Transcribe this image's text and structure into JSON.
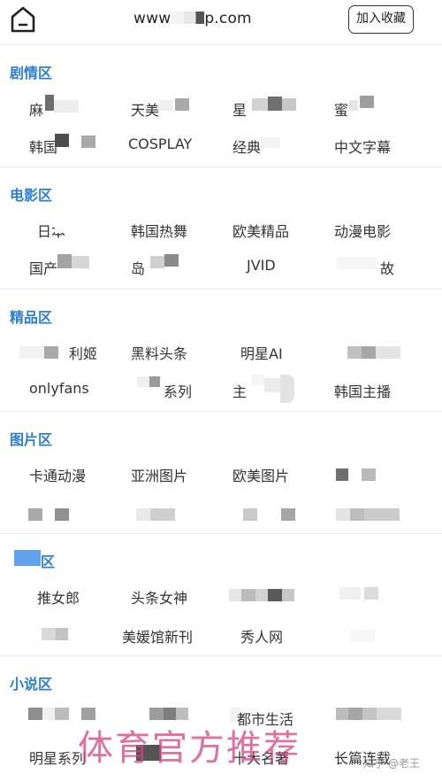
{
  "header": {
    "url_prefix": "www",
    "url_suffix": "p.com",
    "bookmark_label": "加入收藏"
  },
  "sections": [
    {
      "title": "剧情区",
      "items": [
        "麻",
        "天美",
        "星",
        "蜜",
        "韩国",
        "COSPLAY",
        "经典",
        "中文字幕"
      ]
    },
    {
      "title": "电影区",
      "items": [
        "日本",
        "韩国热舞",
        "欧美精品",
        "动漫电影",
        "国产",
        "岛",
        "JVID",
        "故"
      ]
    },
    {
      "title": "精品区",
      "items": [
        "利姬",
        "黑料头条",
        "明星AI",
        "onlyfans",
        "系列",
        "主",
        "韩国主播"
      ]
    },
    {
      "title": "图片区",
      "items": [
        "卡通动漫",
        "亚洲图片",
        "欧美图片"
      ]
    },
    {
      "title": "区",
      "items": [
        "推女郎",
        "头条女神",
        "美媛馆新刊",
        "秀人网"
      ]
    },
    {
      "title": "小说区",
      "items": [
        "都市生活",
        "明星系列",
        "十大名著",
        "长篇连载"
      ]
    }
  ],
  "watermark": "体育官方推荐",
  "credit": "知乎 @老王",
  "colors": {
    "section_title": "#2c7fd0",
    "watermark": "#d3427d",
    "text": "#333333"
  }
}
